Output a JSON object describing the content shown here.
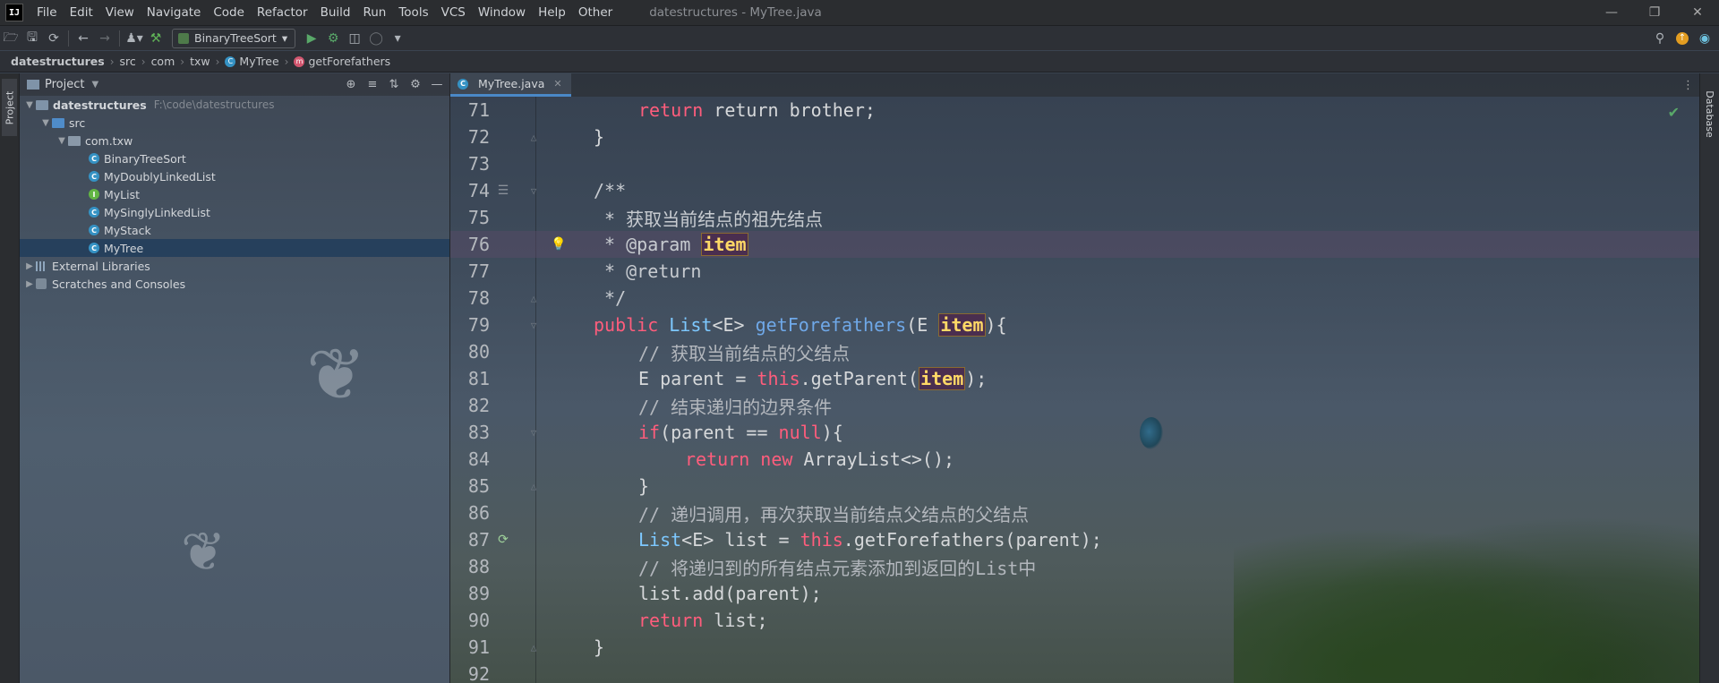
{
  "app": {
    "logo_text": "IJ",
    "window_title": "datestructures - MyTree.java",
    "menu": [
      "File",
      "Edit",
      "View",
      "Navigate",
      "Code",
      "Refactor",
      "Build",
      "Run",
      "Tools",
      "VCS",
      "Window",
      "Help",
      "Other"
    ]
  },
  "toolbar": {
    "run_config": "BinaryTreeSort"
  },
  "breadcrumb": {
    "project": "datestructures",
    "items": [
      "src",
      "com",
      "txw"
    ],
    "class_name": "MyTree",
    "method_name": "getForefathers"
  },
  "sidebar": {
    "left_tab": "Project",
    "right_tab": "Database"
  },
  "project_panel": {
    "title": "Project",
    "root_name": "datestructures",
    "root_path": "F:\\code\\datestructures",
    "src": "src",
    "package": "com.txw",
    "files": [
      {
        "name": "BinaryTreeSort",
        "kind": "class"
      },
      {
        "name": "MyDoublyLinkedList",
        "kind": "class"
      },
      {
        "name": "MyList",
        "kind": "interface"
      },
      {
        "name": "MySinglyLinkedList",
        "kind": "class"
      },
      {
        "name": "MyStack",
        "kind": "class"
      },
      {
        "name": "MyTree",
        "kind": "class"
      }
    ],
    "external_libraries": "External Libraries",
    "scratches": "Scratches and Consoles"
  },
  "editor": {
    "tab_label": "MyTree.java",
    "line_numbers": [
      "71",
      "72",
      "73",
      "74",
      "75",
      "76",
      "77",
      "78",
      "79",
      "80",
      "81",
      "82",
      "83",
      "84",
      "85",
      "86",
      "87",
      "88",
      "89",
      "90",
      "91",
      "92"
    ],
    "code": {
      "l71": "return brother;",
      "l72": "}",
      "l74": "/**",
      "l75": " * 获取当前结点的祖先结点",
      "l76_tag": " * @param ",
      "l76_param": "item",
      "l77": " * @return",
      "l78": " */",
      "l79_mod": "public ",
      "l79_type": "List",
      "l79_gen": "<E> ",
      "l79_fn": "getForefathers",
      "l79_open": "(E ",
      "l79_param": "item",
      "l79_close": "){",
      "l80": "// 获取当前结点的父结点",
      "l81_a": "E parent = ",
      "l81_this": "this",
      "l81_b": ".getParent(",
      "l81_param": "item",
      "l81_c": ");",
      "l82": "// 结束递归的边界条件",
      "l83_if": "if",
      "l83_a": "(parent == ",
      "l83_null": "null",
      "l83_b": "){",
      "l84_ret": "return ",
      "l84_new": "new ",
      "l84_rest": "ArrayList<>();",
      "l85": "}",
      "l86": "// 递归调用，再次获取当前结点父结点的父结点",
      "l87_type": "List",
      "l87_a": "<E> list = ",
      "l87_this": "this",
      "l87_b": ".getForefathers(parent);",
      "l88": "// 将递归到的所有结点元素添加到返回的List中",
      "l89": "list.add(parent);",
      "l90_ret": "return ",
      "l90_rest": "list;",
      "l91": "}"
    }
  }
}
